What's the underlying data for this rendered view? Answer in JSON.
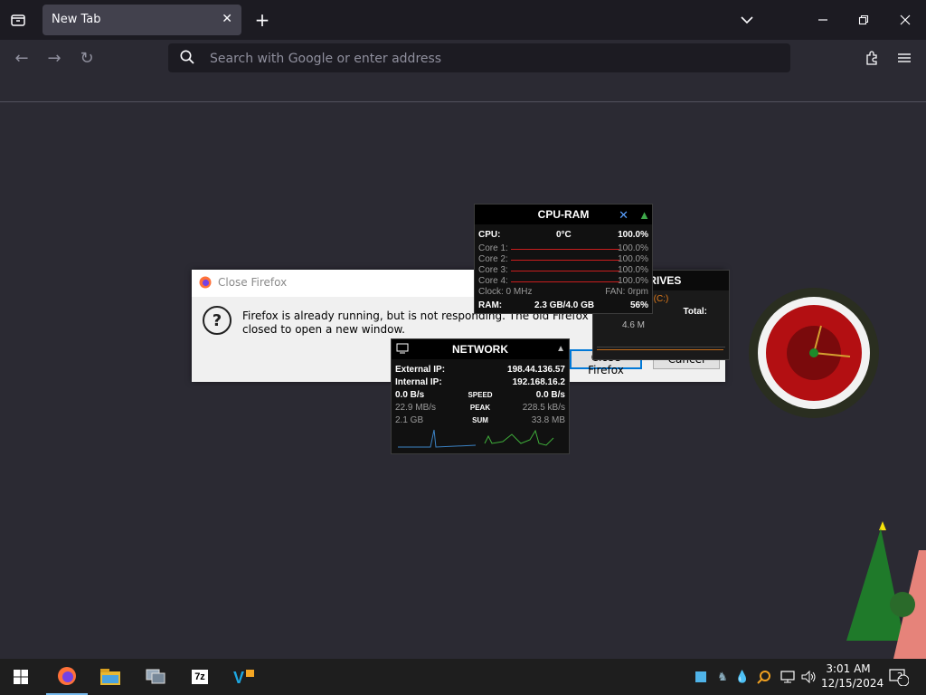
{
  "browser": {
    "tab_title": "New Tab",
    "search_placeholder": "Search with Google or enter address"
  },
  "dialog": {
    "title": "Close Firefox",
    "message": "Firefox is already running, but is not responding. The old Firefox process must be closed to open a new window.",
    "close_label": "Close Firefox",
    "cancel_label": "Cancel"
  },
  "cpu_widget": {
    "title": "CPU-RAM",
    "cpu_label": "CPU:",
    "cpu_temp": "0°C",
    "cpu_value": "100.0%",
    "cores": [
      {
        "label": "Core 1:",
        "value": "100.0%"
      },
      {
        "label": "Core 2:",
        "value": "100.0%"
      },
      {
        "label": "Core 3:",
        "value": "100.0%"
      },
      {
        "label": "Core 4:",
        "value": "100.0%"
      }
    ],
    "clock": "Clock: 0 MHz",
    "fan": "FAN: 0rpm",
    "ram_label": "RAM:",
    "ram_value": "2.3 GB/4.0 GB",
    "ram_percent": "56%"
  },
  "drives_widget": {
    "title": "DRIVES",
    "drive": "(C:)",
    "total_label": "Total:",
    "size": "4.6 M"
  },
  "network_widget": {
    "title": "NETWORK",
    "external_ip_label": "External IP:",
    "external_ip": "198.44.136.57",
    "internal_ip_label": "Internal IP:",
    "internal_ip": "192.168.16.2",
    "speed_down": "0.0 B/s",
    "speed_label": "SPEED",
    "speed_up": "0.0 B/s",
    "peak_down": "22.9 MB/s",
    "peak_label": "PEAK",
    "peak_up": "228.5 kB/s",
    "sum_down": "2.1 GB",
    "sum_label": "SUM",
    "sum_up": "33.8 MB"
  },
  "taskbar": {
    "time": "3:01 AM",
    "date": "12/15/2024",
    "notifications": "2",
    "sevenzip_label": "7z"
  },
  "colors": {
    "accent": "#0078d7",
    "browser_bg": "#2b2a33",
    "toolbar_bg": "#1c1b22"
  }
}
